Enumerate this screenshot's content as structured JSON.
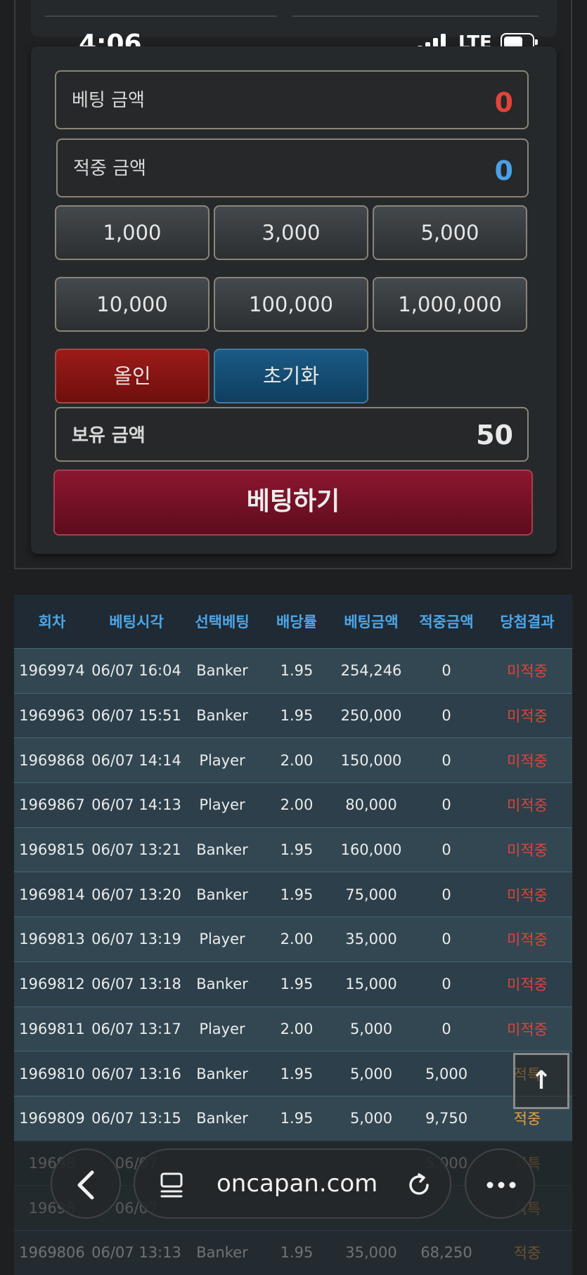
{
  "status": {
    "time": "4:06",
    "network": "LTE"
  },
  "form": {
    "bet_amount_label": "베팅 금액",
    "bet_amount_value": "0",
    "win_amount_label": "적중 금액",
    "win_amount_value": "0",
    "chips": [
      "1,000",
      "3,000",
      "5,000",
      "10,000",
      "100,000",
      "1,000,000"
    ],
    "allin_label": "올인",
    "reset_label": "초기화",
    "balance_label": "보유 금액",
    "balance_value": "50",
    "bet_button_label": "베팅하기"
  },
  "table": {
    "headers": [
      "회차",
      "베팅시각",
      "선택베팅",
      "배당률",
      "베팅금액",
      "적중금액",
      "당첨결과"
    ],
    "rows": [
      [
        "1969974",
        "06/07 16:04",
        "Banker",
        "1.95",
        "254,246",
        "0",
        "미적중"
      ],
      [
        "1969963",
        "06/07 15:51",
        "Banker",
        "1.95",
        "250,000",
        "0",
        "미적중"
      ],
      [
        "1969868",
        "06/07 14:14",
        "Player",
        "2.00",
        "150,000",
        "0",
        "미적중"
      ],
      [
        "1969867",
        "06/07 14:13",
        "Player",
        "2.00",
        "80,000",
        "0",
        "미적중"
      ],
      [
        "1969815",
        "06/07 13:21",
        "Banker",
        "1.95",
        "160,000",
        "0",
        "미적중"
      ],
      [
        "1969814",
        "06/07 13:20",
        "Banker",
        "1.95",
        "75,000",
        "0",
        "미적중"
      ],
      [
        "1969813",
        "06/07 13:19",
        "Player",
        "2.00",
        "35,000",
        "0",
        "미적중"
      ],
      [
        "1969812",
        "06/07 13:18",
        "Banker",
        "1.95",
        "15,000",
        "0",
        "미적중"
      ],
      [
        "1969811",
        "06/07 13:17",
        "Player",
        "2.00",
        "5,000",
        "0",
        "미적중"
      ],
      [
        "1969810",
        "06/07 13:16",
        "Banker",
        "1.95",
        "5,000",
        "5,000",
        "적특"
      ],
      [
        "1969809",
        "06/07 13:15",
        "Banker",
        "1.95",
        "5,000",
        "9,750",
        "적중"
      ],
      [
        "19698",
        "06/07",
        "",
        "",
        "",
        "5,000",
        "적특"
      ],
      [
        "19698",
        "06/07",
        "",
        "",
        "",
        "",
        "적특"
      ],
      [
        "1969806",
        "06/07 13:13",
        "Banker",
        "1.95",
        "35,000",
        "68,250",
        "적중"
      ]
    ]
  },
  "browser": {
    "url": "oncapan.com"
  },
  "colors": {
    "miss": "#e0443a",
    "hit": "#e8a23a",
    "header": "#4da6e8",
    "bet_button": "#8c1630"
  }
}
